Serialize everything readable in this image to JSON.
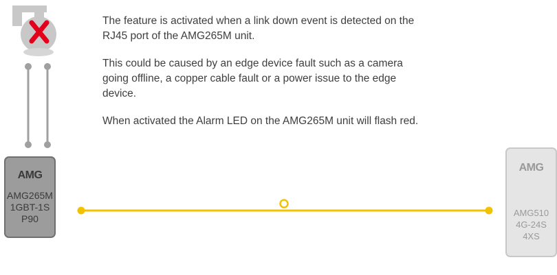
{
  "description": {
    "paragraph_1": "The feature is activated when a link down event is detected on the RJ45 port of the AMG265M unit.",
    "paragraph_2": "This could be caused by an edge device fault such as a camera going offline, a copper cable fault or a power issue to the edge device.",
    "paragraph_3": "When activated the Alarm LED on the AMG265M unit will flash red."
  },
  "primary_unit": {
    "brand": "AMG",
    "model_line_1": "AMG265M",
    "model_line_2": "1GBT-1S",
    "model_line_3": "P90"
  },
  "remote_unit": {
    "brand": "AMG",
    "model_line_1": "AMG510",
    "model_line_2": "4G-24S",
    "model_line_3": "4XS"
  },
  "colors": {
    "fiber_link": "#f2c200",
    "copper_link": "#a0a0a0",
    "fault_mark": "#e2001a",
    "camera": "#c8c8c8",
    "text": "#3e3e3e"
  },
  "icons": {
    "camera": "dome-camera-icon",
    "fault": "red-x-icon"
  }
}
